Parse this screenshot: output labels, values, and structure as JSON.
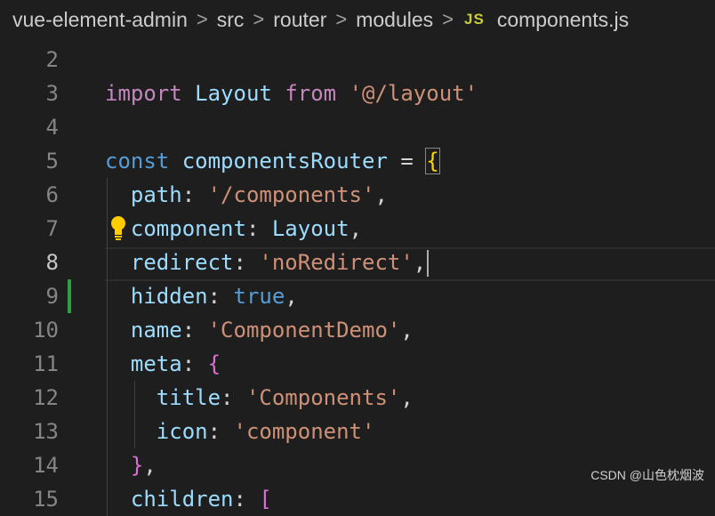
{
  "breadcrumb": {
    "items": [
      "vue-element-admin",
      "src",
      "router",
      "modules"
    ],
    "separator": ">",
    "file_type_icon": "JS",
    "file_name": "components.js"
  },
  "editor": {
    "active_line": "8",
    "modified_line": "9",
    "lines": [
      {
        "num": "2"
      },
      {
        "num": "3",
        "tokens": [
          [
            "import",
            "kw-purple"
          ],
          [
            " ",
            "punct"
          ],
          [
            "Layout",
            "ident"
          ],
          [
            " ",
            "punct"
          ],
          [
            "from",
            "kw-purple"
          ],
          [
            " ",
            "punct"
          ],
          [
            "'@/layout'",
            "str"
          ]
        ]
      },
      {
        "num": "4"
      },
      {
        "num": "5",
        "tokens": [
          [
            "const",
            "kw-blue"
          ],
          [
            " ",
            "punct"
          ],
          [
            "componentsRouter",
            "ident"
          ],
          [
            " = ",
            "punct"
          ],
          [
            "{",
            "brace-y brace-match"
          ]
        ]
      },
      {
        "num": "6",
        "tokens": [
          [
            "  ",
            "punct"
          ],
          [
            "path",
            "ident"
          ],
          [
            ": ",
            "punct"
          ],
          [
            "'/components'",
            "str"
          ],
          [
            ",",
            "punct"
          ]
        ]
      },
      {
        "num": "7",
        "tokens": [
          [
            "  ",
            "punct"
          ],
          [
            "component",
            "ident"
          ],
          [
            ": ",
            "punct"
          ],
          [
            "Layout",
            "ident"
          ],
          [
            ",",
            "punct"
          ]
        ]
      },
      {
        "num": "8",
        "tokens": [
          [
            "  ",
            "punct"
          ],
          [
            "redirect",
            "ident"
          ],
          [
            ": ",
            "punct"
          ],
          [
            "'noRedirect'",
            "str"
          ],
          [
            ",",
            "punct"
          ]
        ]
      },
      {
        "num": "9",
        "tokens": [
          [
            "  ",
            "punct"
          ],
          [
            "hidden",
            "ident"
          ],
          [
            ": ",
            "punct"
          ],
          [
            "true",
            "kw-blue"
          ],
          [
            ",",
            "punct"
          ]
        ]
      },
      {
        "num": "10",
        "tokens": [
          [
            "  ",
            "punct"
          ],
          [
            "name",
            "ident"
          ],
          [
            ": ",
            "punct"
          ],
          [
            "'ComponentDemo'",
            "str"
          ],
          [
            ",",
            "punct"
          ]
        ]
      },
      {
        "num": "11",
        "tokens": [
          [
            "  ",
            "punct"
          ],
          [
            "meta",
            "ident"
          ],
          [
            ": ",
            "punct"
          ],
          [
            "{",
            "brace-p"
          ]
        ]
      },
      {
        "num": "12",
        "tokens": [
          [
            "    ",
            "punct"
          ],
          [
            "title",
            "ident"
          ],
          [
            ": ",
            "punct"
          ],
          [
            "'Components'",
            "str"
          ],
          [
            ",",
            "punct"
          ]
        ]
      },
      {
        "num": "13",
        "tokens": [
          [
            "    ",
            "punct"
          ],
          [
            "icon",
            "ident"
          ],
          [
            ": ",
            "punct"
          ],
          [
            "'component'",
            "str"
          ]
        ]
      },
      {
        "num": "14",
        "tokens": [
          [
            "  ",
            "punct"
          ],
          [
            "}",
            "brace-p"
          ],
          [
            ",",
            "punct"
          ]
        ]
      },
      {
        "num": "15",
        "tokens": [
          [
            "  ",
            "punct"
          ],
          [
            "children",
            "ident"
          ],
          [
            ": ",
            "punct"
          ],
          [
            "[",
            "brace-p"
          ]
        ]
      }
    ]
  },
  "watermark": "CSDN @山色枕烟波",
  "icons": {
    "lightbulb": "lightbulb-icon",
    "js_file": "js-file-icon"
  },
  "colors": {
    "background": "#1e1e1e",
    "keyword": "#c586c0",
    "string": "#ce9178",
    "variable": "#9cdcfe",
    "git_modified": "#2ea043"
  }
}
